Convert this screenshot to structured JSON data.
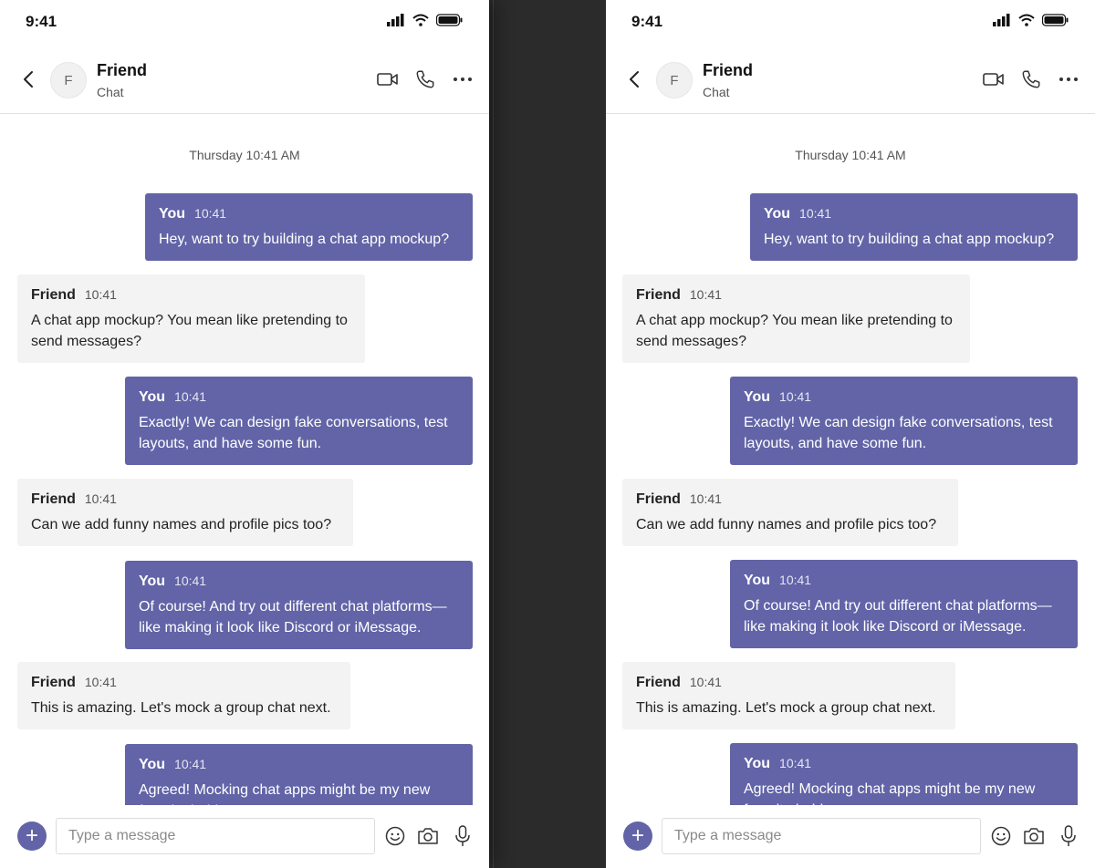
{
  "status": {
    "time": "9:41"
  },
  "header": {
    "avatar_initial": "F",
    "name": "Friend",
    "subtitle": "Chat"
  },
  "chat": {
    "date_separator": "Thursday 10:41 AM",
    "messages": [
      {
        "sender": "You",
        "time": "10:41",
        "text": "Hey, want to try building a chat app mockup?",
        "outgoing": true
      },
      {
        "sender": "Friend",
        "time": "10:41",
        "text": "A chat app mockup? You mean like pretending to send messages?",
        "outgoing": false
      },
      {
        "sender": "You",
        "time": "10:41",
        "text": "Exactly! We can design fake conversations, test layouts, and have some fun.",
        "outgoing": true
      },
      {
        "sender": "Friend",
        "time": "10:41",
        "text": "Can we add funny names and profile pics too?",
        "outgoing": false
      },
      {
        "sender": "You",
        "time": "10:41",
        "text": "Of course! And try out different chat platforms—like making it look like Discord or iMessage.",
        "outgoing": true
      },
      {
        "sender": "Friend",
        "time": "10:41",
        "text": "This is amazing. Let's mock a group chat next.",
        "outgoing": false
      },
      {
        "sender": "You",
        "time": "10:41",
        "text": "Agreed! Mocking chat apps might be my new favorite hobby.",
        "outgoing": true
      }
    ]
  },
  "composer": {
    "placeholder": "Type a message",
    "add_label": "+"
  },
  "icons": {
    "back": "chevron-left-icon",
    "video": "video-camera-icon",
    "call": "phone-icon",
    "more": "more-horizontal-icon",
    "emoji": "emoji-icon",
    "camera": "camera-icon",
    "mic": "microphone-icon",
    "signal": "signal-icon",
    "wifi": "wifi-icon",
    "battery": "battery-icon"
  },
  "colors": {
    "accent": "#6264a7",
    "incoming_bubble": "#f3f3f3",
    "background_gap": "#2a2a2a"
  }
}
